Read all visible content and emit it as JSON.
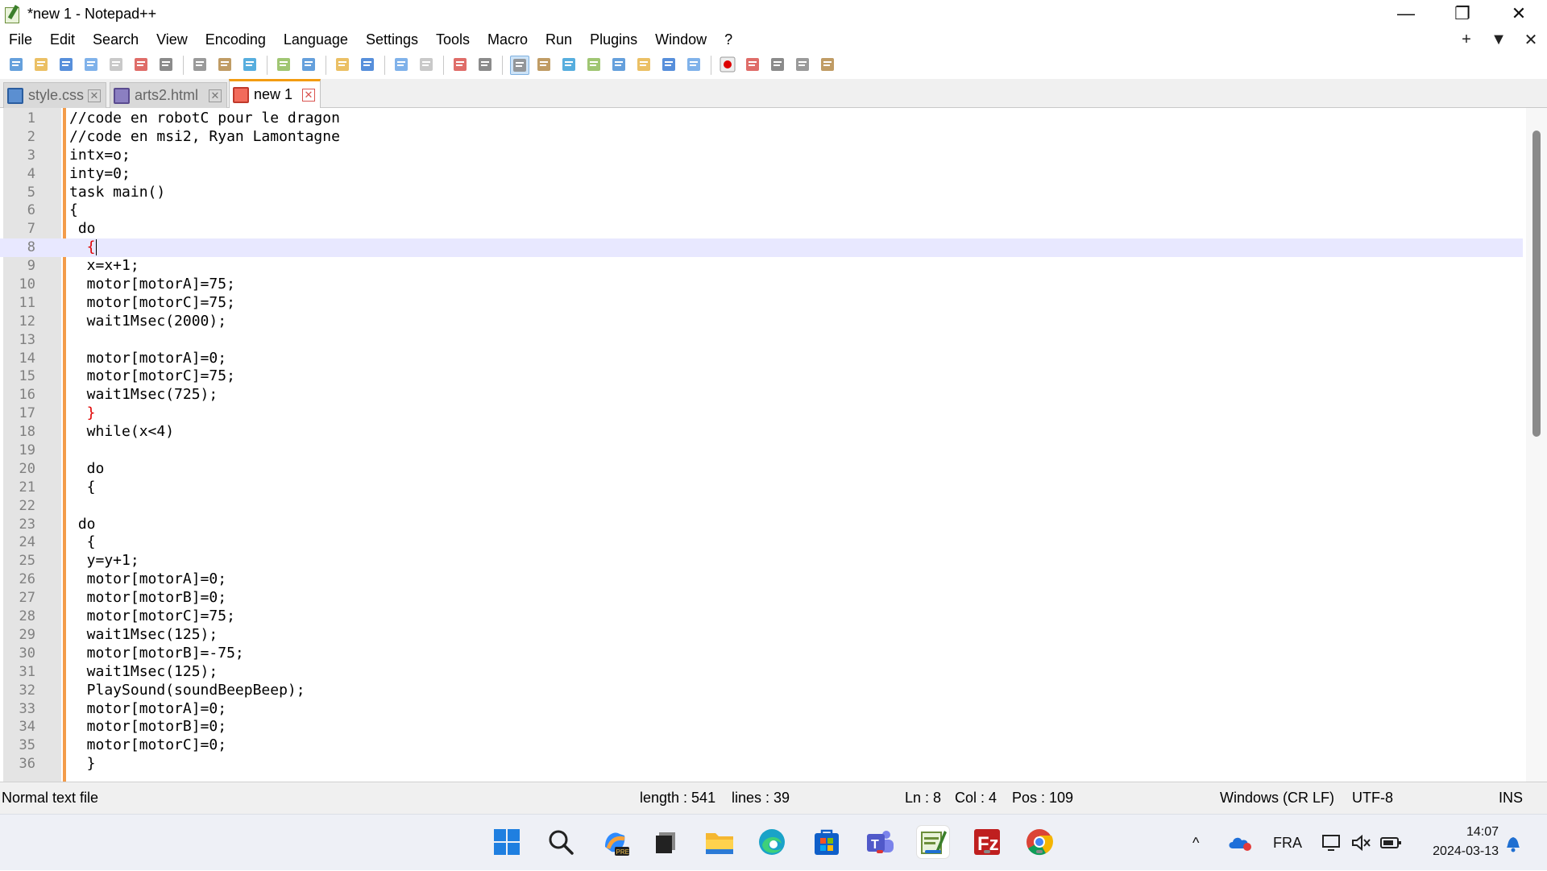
{
  "window": {
    "title": "*new 1 - Notepad++",
    "minimize": "—",
    "maximize": "❐",
    "close": "✕"
  },
  "menu": {
    "items": [
      "File",
      "Edit",
      "Search",
      "View",
      "Encoding",
      "Language",
      "Settings",
      "Tools",
      "Macro",
      "Run",
      "Plugins",
      "Window",
      "?"
    ],
    "right_plus": "+",
    "right_arrow": "▼",
    "right_close": "✕"
  },
  "toolbar": {
    "icons": [
      "new-file-icon",
      "open-file-icon",
      "save-icon",
      "save-all-icon",
      "close-icon",
      "close-all-icon",
      "print-icon",
      "separator",
      "cut-icon",
      "copy-icon",
      "paste-icon",
      "separator",
      "undo-icon",
      "redo-icon",
      "separator",
      "find-icon",
      "replace-icon",
      "separator",
      "zoom-in-icon",
      "zoom-out-icon",
      "separator",
      "sync-vertical-icon",
      "sync-horizontal-icon",
      "separator",
      "word-wrap-icon",
      "show-all-chars-icon",
      "indent-guide-icon",
      "user-defined-language-icon",
      "document-map-icon",
      "function-list-icon",
      "folder-as-workspace-icon",
      "monitoring-icon",
      "separator",
      "record-macro-icon",
      "stop-record-icon",
      "playback-macro-icon",
      "run-macro-multiple-icon",
      "save-macro-icon"
    ]
  },
  "tabs": [
    {
      "label": "style.css",
      "state": "saved"
    },
    {
      "label": "arts2.html",
      "state": "saved"
    },
    {
      "label": "new 1",
      "state": "modified"
    }
  ],
  "editor": {
    "current_line": 8,
    "lines": [
      "//code en robotC pour le dragon",
      "//code en msi2, Ryan Lamontagne",
      "intx=o;",
      "inty=0;",
      "task main()",
      "{",
      " do",
      "  {",
      "  x=x+1;",
      "  motor[motorA]=75;",
      "  motor[motorC]=75;",
      "  wait1Msec(2000);",
      "",
      "  motor[motorA]=0;",
      "  motor[motorC]=75;",
      "  wait1Msec(725);",
      "  }",
      "  while(x<4)",
      "",
      "  do",
      "  {",
      "",
      " do",
      "  {",
      "  y=y+1;",
      "  motor[motorA]=0;",
      "  motor[motorB]=0;",
      "  motor[motorC]=75;",
      "  wait1Msec(125);",
      "  motor[motorB]=-75;",
      "  wait1Msec(125);",
      "  PlaySound(soundBeepBeep);",
      "  motor[motorA]=0;",
      "  motor[motorB]=0;",
      "  motor[motorC]=0;",
      "  }"
    ]
  },
  "status": {
    "file_type": "Normal text file",
    "length": "length : 541",
    "lines": "lines : 39",
    "ln": "Ln : 8",
    "col": "Col : 4",
    "pos": "Pos : 109",
    "eol": "Windows (CR LF)",
    "encoding": "UTF-8",
    "mode": "INS"
  },
  "taskbar": {
    "language": "FRA",
    "time": "14:07",
    "date": "2024-03-13",
    "chevron": "^"
  }
}
